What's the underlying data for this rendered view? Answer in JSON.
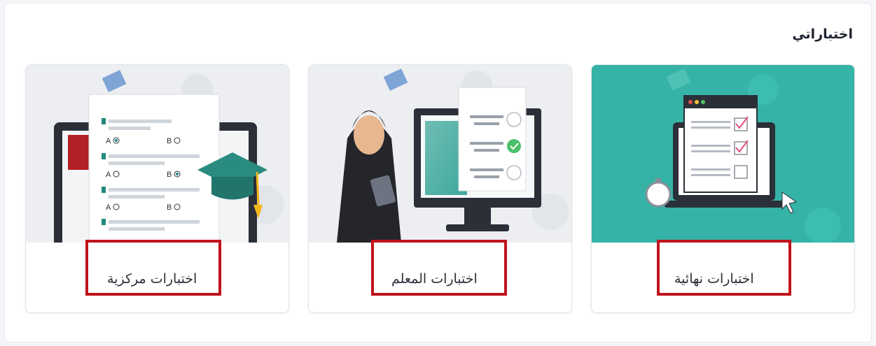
{
  "section": {
    "title": "اختباراتي"
  },
  "cards": [
    {
      "label": "اختبارات نهائية",
      "icon": "final-exams-illustration",
      "bg": "#35b3a6"
    },
    {
      "label": "اختبارات المعلم",
      "icon": "teacher-exams-illustration",
      "bg": "#eceef1"
    },
    {
      "label": "اختبارات مركزية",
      "icon": "central-exams-illustration",
      "bg": "#eceef1"
    }
  ],
  "highlight_color": "#c0141b",
  "answer_letters": {
    "a": "A",
    "b": "B"
  }
}
